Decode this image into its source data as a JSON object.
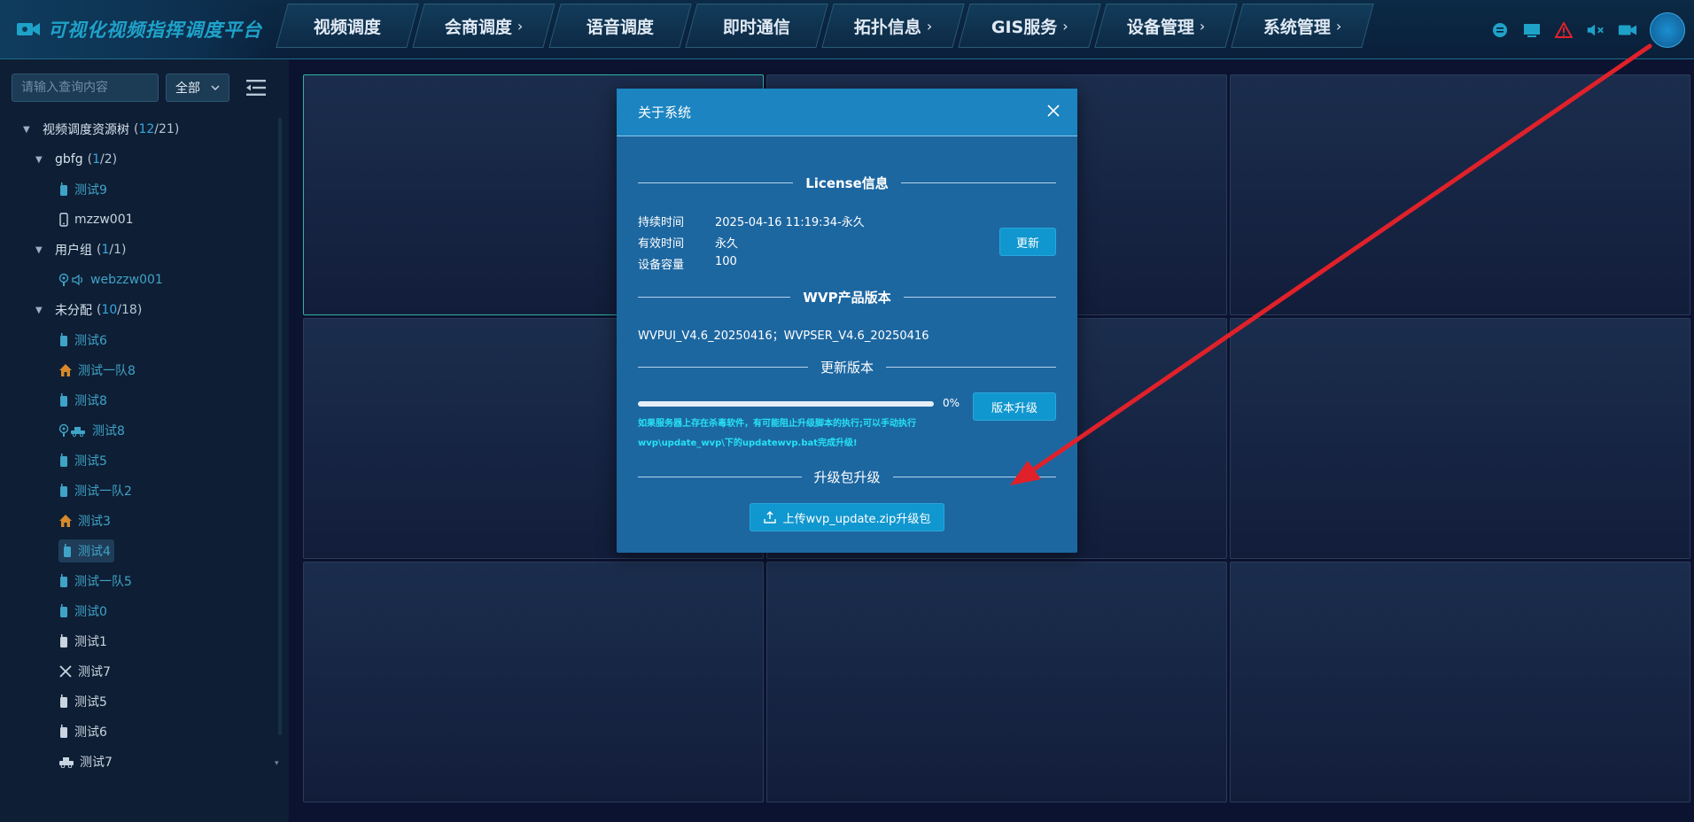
{
  "app": {
    "title": "可视化视频指挥调度平台"
  },
  "nav": [
    {
      "label": "视频调度",
      "chevron": ""
    },
    {
      "label": "会商调度",
      "chevron": "›"
    },
    {
      "label": "语音调度",
      "chevron": ""
    },
    {
      "label": "即时通信",
      "chevron": ""
    },
    {
      "label": "拓扑信息",
      "chevron": "›"
    },
    {
      "label": "GIS服务",
      "chevron": "›"
    },
    {
      "label": "设备管理",
      "chevron": "›"
    },
    {
      "label": "系统管理",
      "chevron": "›"
    }
  ],
  "top_icons": [
    "message-icon",
    "screen-icon",
    "alarm-icon",
    "mute-icon",
    "video-icon",
    "avatar"
  ],
  "sidebar": {
    "search_placeholder": "请输入查询内容",
    "filter_value": "全部",
    "tree": [
      {
        "type": "group",
        "level": 0,
        "label": "视频调度资源树",
        "online": "12",
        "total": "21"
      },
      {
        "type": "group",
        "level": 1,
        "label": "gbfg",
        "online": "1",
        "total": "2"
      },
      {
        "type": "leaf",
        "level": 2,
        "label": "测试9",
        "icon": "walkie-icon",
        "state": "online"
      },
      {
        "type": "leaf",
        "level": 2,
        "label": "mzzw001",
        "icon": "phone-icon",
        "state": "offline"
      },
      {
        "type": "group",
        "level": 1,
        "label": "用户组",
        "online": "1",
        "total": "1"
      },
      {
        "type": "leaf",
        "level": 2,
        "label": "webzzw001",
        "icon": "camera-speaker-icon",
        "state": "online"
      },
      {
        "type": "group",
        "level": 1,
        "label": "未分配",
        "online": "10",
        "total": "18"
      },
      {
        "type": "leaf",
        "level": 2,
        "label": "测试6",
        "icon": "walkie-icon",
        "state": "online"
      },
      {
        "type": "leaf",
        "level": 2,
        "label": "测试一队8",
        "icon": "home-icon",
        "state": "online"
      },
      {
        "type": "leaf",
        "level": 2,
        "label": "测试8",
        "icon": "walkie-icon",
        "state": "online"
      },
      {
        "type": "leaf",
        "level": 2,
        "label": "测试8",
        "icon": "camera-vehicle-icon",
        "state": "online"
      },
      {
        "type": "leaf",
        "level": 2,
        "label": "测试5",
        "icon": "walkie-icon",
        "state": "online"
      },
      {
        "type": "leaf",
        "level": 2,
        "label": "测试一队2",
        "icon": "walkie-icon",
        "state": "online"
      },
      {
        "type": "leaf",
        "level": 2,
        "label": "测试3",
        "icon": "home-icon",
        "state": "online"
      },
      {
        "type": "leaf",
        "level": 2,
        "label": "测试4",
        "icon": "walkie-icon",
        "state": "online",
        "selected": true
      },
      {
        "type": "leaf",
        "level": 2,
        "label": "测试一队5",
        "icon": "walkie-icon",
        "state": "online"
      },
      {
        "type": "leaf",
        "level": 2,
        "label": "测试0",
        "icon": "walkie-icon",
        "state": "online"
      },
      {
        "type": "leaf",
        "level": 2,
        "label": "测试1",
        "icon": "walkie-icon",
        "state": "offline"
      },
      {
        "type": "leaf",
        "level": 2,
        "label": "测试7",
        "icon": "tools-icon",
        "state": "offline"
      },
      {
        "type": "leaf",
        "level": 2,
        "label": "测试5",
        "icon": "walkie-icon",
        "state": "offline"
      },
      {
        "type": "leaf",
        "level": 2,
        "label": "测试6",
        "icon": "walkie-icon",
        "state": "offline"
      },
      {
        "type": "leaf",
        "level": 2,
        "label": "测试7",
        "icon": "vehicle-icon",
        "state": "offline"
      }
    ]
  },
  "modal": {
    "title": "关于系统",
    "license_section": "License信息",
    "license": [
      {
        "key": "持续时间",
        "value": "2025-04-16 11:19:34-永久"
      },
      {
        "key": "有效时间",
        "value": "永久"
      },
      {
        "key": "设备容量",
        "value": "100"
      }
    ],
    "update_btn": "更新",
    "product_section": "WVP产品版本",
    "version": "WVPUI_V4.6_20250416；WVPSER_V4.6_20250416",
    "update_section": "更新版本",
    "progress_percent": 0,
    "progress_label": "0%",
    "upgrade_btn": "版本升级",
    "notice": "如果服务器上存在杀毒软件，有可能阻止升级脚本的执行;可以手动执行wvp\\update_wvp\\下的updatewvp.bat完成升级!",
    "package_section": "升级包升级",
    "upload_btn": "上传wvp_update.zip升级包"
  },
  "colors": {
    "accent": "#1fa2c9",
    "online": "#3fa3c8",
    "modal_bg": "#1d67a1",
    "modal_header": "#1b84c1",
    "notice": "#26e2f5",
    "arrow": "#e0212a"
  }
}
